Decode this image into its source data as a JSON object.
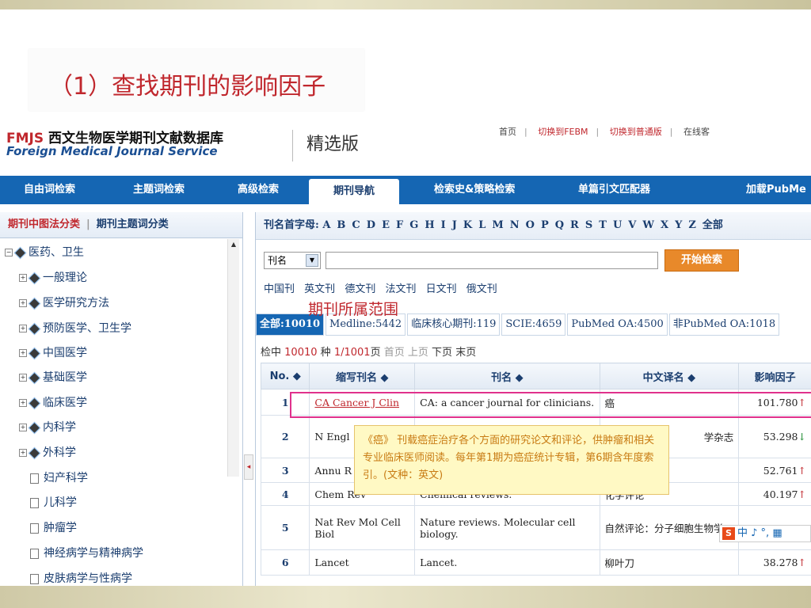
{
  "slide": {
    "title": "（1）查找期刊的影响因子"
  },
  "header": {
    "logo_abbr": "FMJS",
    "logo_cn": "西文生物医学期刊文献数据库",
    "logo_en": "Foreign Medical Journal Service",
    "edition": "精选版",
    "links": [
      "首页",
      "切换到FEBM",
      "切换到普通版",
      "在线客"
    ]
  },
  "nav": {
    "items": [
      "自由词检索",
      "主题词检索",
      "高级检索",
      "期刊导航",
      "检索史&策略检索",
      "单篇引文匹配器",
      "加载PubMe"
    ],
    "active": "期刊导航"
  },
  "left_panel": {
    "head_a": "期刊中图法分类",
    "head_b": "期刊主题词分类",
    "tree": [
      {
        "label": "医药、卫生",
        "kind": "root"
      },
      {
        "label": "一般理论",
        "kind": "branch"
      },
      {
        "label": "医学研究方法",
        "kind": "branch"
      },
      {
        "label": "预防医学、卫生学",
        "kind": "branch"
      },
      {
        "label": "中国医学",
        "kind": "branch"
      },
      {
        "label": "基础医学",
        "kind": "branch"
      },
      {
        "label": "临床医学",
        "kind": "branch"
      },
      {
        "label": "内科学",
        "kind": "branch"
      },
      {
        "label": "外科学",
        "kind": "branch"
      },
      {
        "label": "妇产科学",
        "kind": "leaf"
      },
      {
        "label": "儿科学",
        "kind": "leaf"
      },
      {
        "label": "肿瘤学",
        "kind": "leaf"
      },
      {
        "label": "神经病学与精神病学",
        "kind": "leaf"
      },
      {
        "label": "皮肤病学与性病学",
        "kind": "leaf"
      }
    ]
  },
  "letters": {
    "label": "刊名首字母:",
    "items": [
      "A",
      "B",
      "C",
      "D",
      "E",
      "F",
      "G",
      "H",
      "I",
      "J",
      "K",
      "L",
      "M",
      "N",
      "O",
      "P",
      "Q",
      "R",
      "S",
      "T",
      "U",
      "V",
      "W",
      "X",
      "Y",
      "Z"
    ],
    "all": "全部"
  },
  "search": {
    "field": "刊名",
    "value": "",
    "button": "开始检索"
  },
  "langs": [
    "中国刊",
    "英文刊",
    "德文刊",
    "法文刊",
    "日文刊",
    "俄文刊"
  ],
  "annotation": "期刊所属范围",
  "scope_tabs": [
    "全部:10010",
    "Medline:5442",
    "临床核心期刊:119",
    "SCIE:4659",
    "PubMed OA:4500",
    "非PubMed OA:1018"
  ],
  "count": {
    "prefix": "检中",
    "total": "10010",
    "unit": "种",
    "page": "1/1001",
    "page_unit": "页",
    "first": "首页",
    "prev": "上页",
    "next": "下页",
    "last": "末页"
  },
  "table": {
    "headers": [
      "No. ◆",
      "缩写刊名 ◆",
      "刊名 ◆",
      "中文译名 ◆",
      "影响因子"
    ],
    "rows": [
      {
        "no": "1",
        "abbr": "CA Cancer J Clin",
        "name": "CA: a cancer journal for clinicians.",
        "cn": "癌",
        "if": "101.780",
        "trend": "↑"
      },
      {
        "no": "2",
        "abbr": "N Engl",
        "name": "",
        "cn": "学杂志",
        "if": "53.298",
        "trend": "↓"
      },
      {
        "no": "3",
        "abbr": "Annu R",
        "name": "",
        "cn": "",
        "if": "52.761",
        "trend": "↑"
      },
      {
        "no": "4",
        "abbr": "Chem Rev",
        "name": "Chemical reviews.",
        "cn": "化学评论",
        "if": "40.197",
        "trend": "↑"
      },
      {
        "no": "5",
        "abbr": "Nat Rev Mol Cell Biol",
        "name": "Nature reviews. Molecular cell biology.",
        "cn": "自然评论：分子细胞生物学",
        "if": "",
        "trend": ""
      },
      {
        "no": "6",
        "abbr": "Lancet",
        "name": "Lancet.",
        "cn": "柳叶刀",
        "if": "38.278",
        "trend": "↑"
      }
    ]
  },
  "tooltip": "《癌》 刊载癌症治疗各个方面的研究论文和评论，供肿瘤和相关专业临床医师阅读。每年第1期为癌症统计专辑，第6期含年度索引。(文种：英文)",
  "ime": {
    "logo": "S",
    "text": "中 ♪ °, ▦"
  },
  "colors": {
    "accent_red": "#c0272d",
    "nav_blue": "#1566b3",
    "highlight": "#e0318c",
    "button_orange": "#e8892a"
  }
}
